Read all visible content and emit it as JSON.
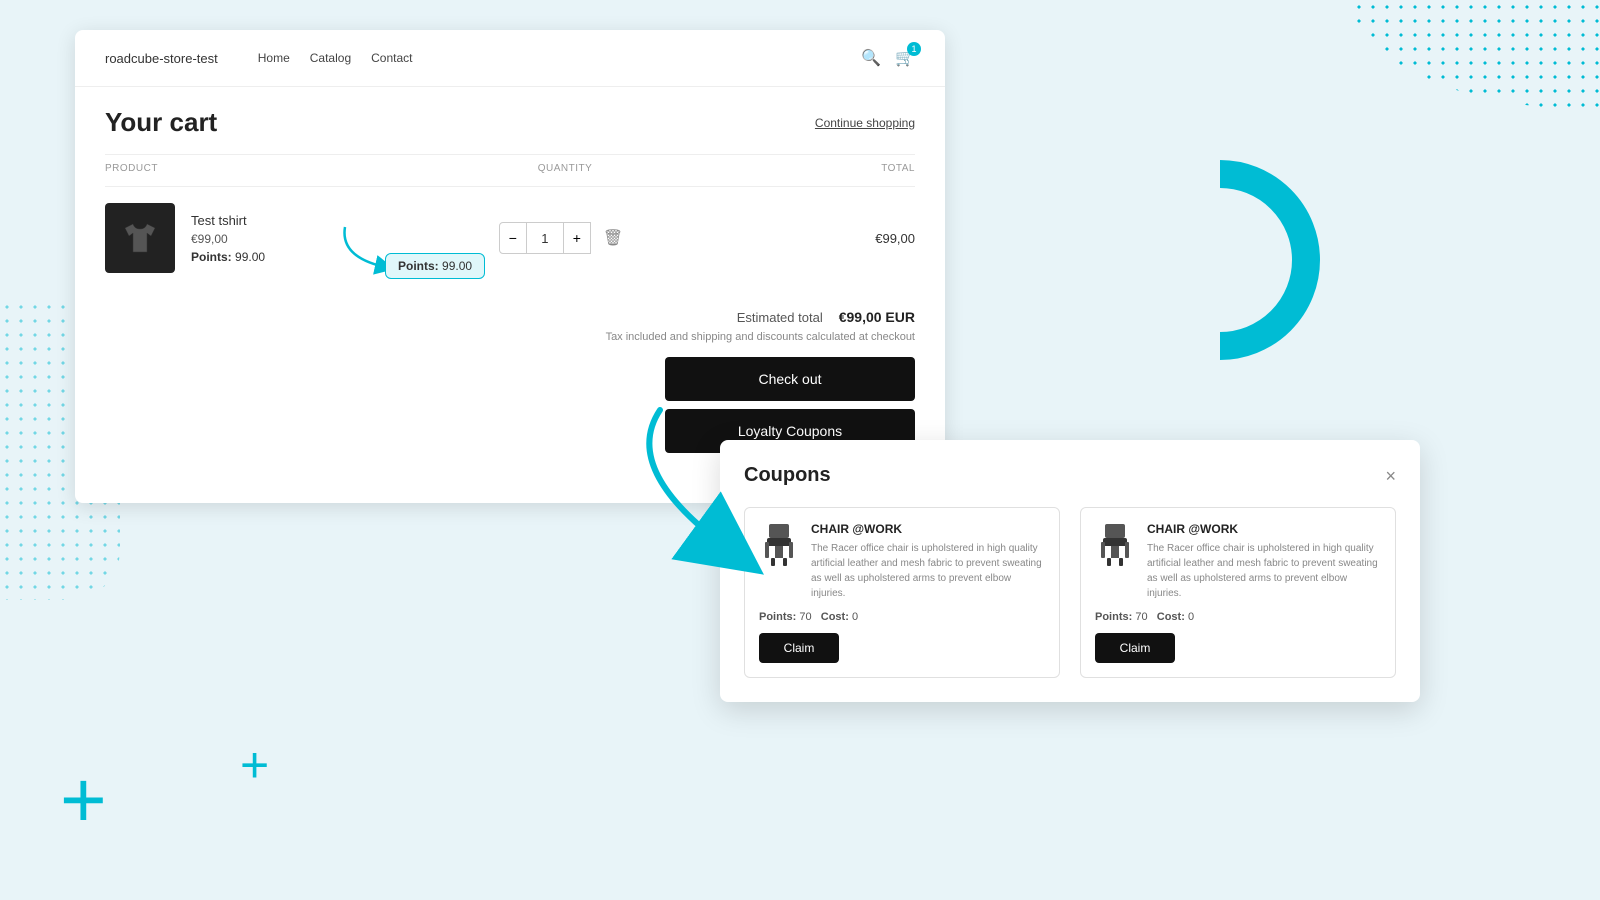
{
  "background": {
    "accent_color": "#00bcd4"
  },
  "nav": {
    "brand": "roadcube-store-test",
    "links": [
      "Home",
      "Catalog",
      "Contact"
    ],
    "cart_count": "1"
  },
  "cart": {
    "title": "Your cart",
    "continue_shopping": "Continue shopping",
    "columns": {
      "product": "PRODUCT",
      "quantity": "QUANTITY",
      "total": "TOTAL"
    },
    "item": {
      "name": "Test tshirt",
      "price": "€99,00",
      "points_label": "Points:",
      "points_value": "99.00",
      "quantity": "1",
      "total": "€99,00"
    },
    "tooltip": {
      "label": "Points:",
      "value": "99.00"
    },
    "summary": {
      "estimated_label": "Estimated total",
      "estimated_value": "€99,00 EUR",
      "tax_note": "Tax included and shipping and discounts calculated at checkout"
    },
    "checkout_btn": "Check out",
    "loyalty_btn": "Loyalty Coupons"
  },
  "coupons_modal": {
    "title": "Coupons",
    "close": "×",
    "coupons": [
      {
        "name": "CHAIR @WORK",
        "description": "The Racer office chair is upholstered in high quality artificial leather and mesh fabric to prevent sweating as well as upholstered arms to prevent elbow injuries.",
        "points_label": "Points:",
        "points_value": "70",
        "cost_label": "Cost:",
        "cost_value": "0",
        "claim_btn": "Claim"
      },
      {
        "name": "CHAIR @WORK",
        "description": "The Racer office chair is upholstered in high quality artificial leather and mesh fabric to prevent sweating as well as upholstered arms to prevent elbow injuries.",
        "points_label": "Points:",
        "points_value": "70",
        "cost_label": "Cost:",
        "cost_value": "0",
        "claim_btn": "Claim"
      }
    ]
  }
}
